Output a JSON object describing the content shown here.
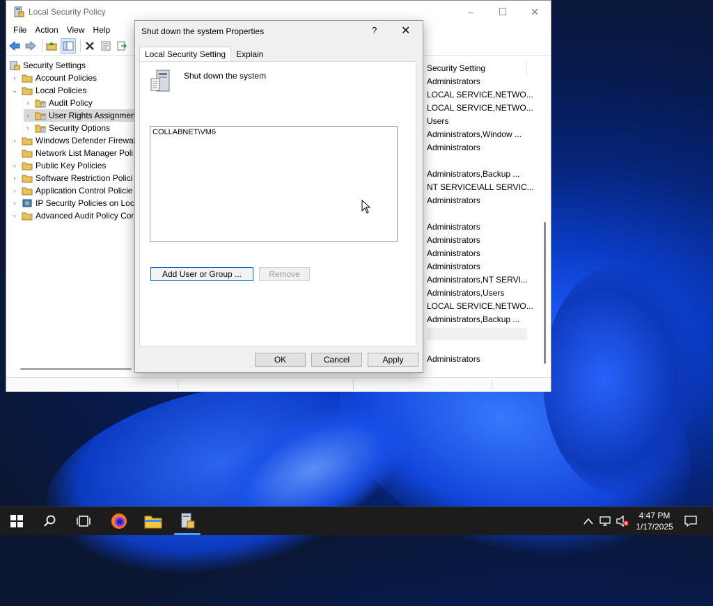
{
  "window": {
    "title": "Local Security Policy",
    "controls": [
      "–",
      "☐",
      "✕"
    ]
  },
  "menu": [
    "File",
    "Action",
    "View",
    "Help"
  ],
  "tree": {
    "items": [
      {
        "label": "Security Settings",
        "level": 0,
        "expander": "",
        "icon": "security-settings-icon"
      },
      {
        "label": "Account Policies",
        "level": 1,
        "expander": "›",
        "icon": "folder-icon"
      },
      {
        "label": "Local Policies",
        "level": 1,
        "expander": "⌄",
        "icon": "folder-icon"
      },
      {
        "label": "Audit Policy",
        "level": 2,
        "expander": "›",
        "icon": "folder-icon"
      },
      {
        "label": "User Rights Assignmen",
        "level": 2,
        "expander": "›",
        "icon": "folder-icon",
        "selected": true
      },
      {
        "label": "Security Options",
        "level": 2,
        "expander": "›",
        "icon": "folder-icon"
      },
      {
        "label": "Windows Defender Firewal",
        "level": 1,
        "expander": "›",
        "icon": "folder-icon"
      },
      {
        "label": "Network List Manager Poli",
        "level": 1,
        "expander": "",
        "icon": "folder-icon"
      },
      {
        "label": "Public Key Policies",
        "level": 1,
        "expander": "›",
        "icon": "folder-icon"
      },
      {
        "label": "Software Restriction Polici",
        "level": 1,
        "expander": "›",
        "icon": "folder-icon"
      },
      {
        "label": "Application Control Policie",
        "level": 1,
        "expander": "›",
        "icon": "folder-icon"
      },
      {
        "label": "IP Security Policies on Loca",
        "level": 1,
        "expander": "›",
        "icon": "ip-security-icon"
      },
      {
        "label": "Advanced Audit Policy Cor",
        "level": 1,
        "expander": "›",
        "icon": "folder-icon"
      }
    ]
  },
  "list": {
    "header": "Security Setting",
    "rows": [
      "Administrators",
      "LOCAL SERVICE,NETWO...",
      "LOCAL SERVICE,NETWO...",
      "Users",
      "Administrators,Window ...",
      "Administrators",
      "",
      "Administrators,Backup ...",
      "NT SERVICE\\ALL SERVIC...",
      "Administrators",
      "",
      "Administrators",
      "Administrators",
      "Administrators",
      "Administrators",
      "Administrators,NT SERVI...",
      "Administrators,Users",
      "LOCAL SERVICE,NETWO...",
      "Administrators,Backup ...",
      "",
      "",
      "Administrators"
    ]
  },
  "dialog": {
    "title": "Shut down the system Properties",
    "help": "?",
    "close": "✕",
    "tabs": [
      "Local Security Setting",
      "Explain"
    ],
    "policy_name": "Shut down the system",
    "users": [
      "COLLABNET\\VM6"
    ],
    "add_button": "Add User or Group ...",
    "remove_button": "Remove",
    "ok_button": "OK",
    "cancel_button": "Cancel",
    "apply_button": "Apply"
  },
  "taskbar": {
    "time": "4:47 PM",
    "date": "1/17/2025"
  },
  "colors": {
    "accent": "#0067c0",
    "taskbar": "#1c1c1c",
    "folder": "#e8c25a"
  }
}
